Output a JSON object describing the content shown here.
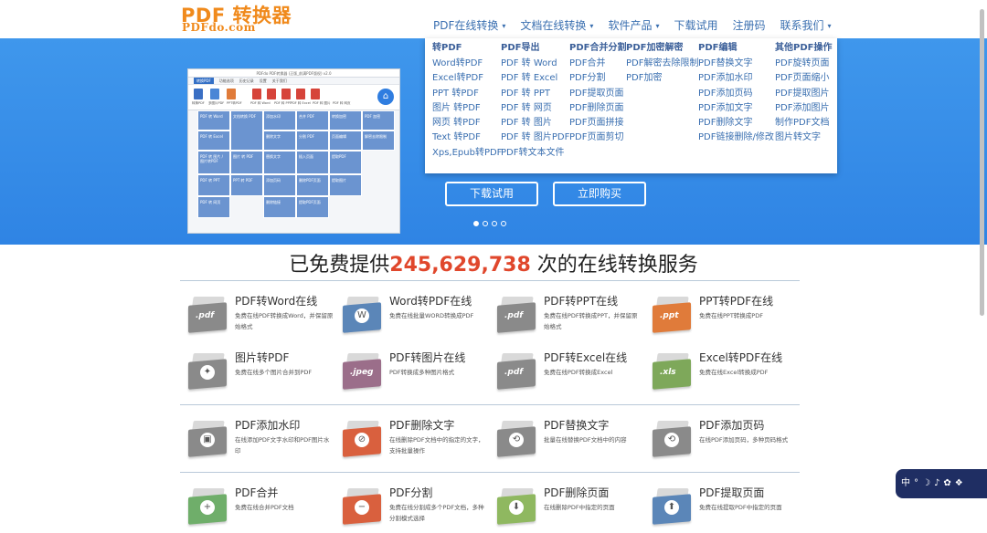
{
  "logo": {
    "main": "PDF 转换器",
    "sub": "PDFdo.com"
  },
  "nav": [
    {
      "label": "PDF在线转换",
      "caret": "▾"
    },
    {
      "label": "文档在线转换",
      "caret": "▾"
    },
    {
      "label": "软件产品",
      "caret": "▾"
    },
    {
      "label": "下载试用",
      "caret": ""
    },
    {
      "label": "注册码",
      "caret": ""
    },
    {
      "label": "联系我们",
      "caret": "▾"
    }
  ],
  "dropdown": [
    {
      "head": "转PDF",
      "items": [
        "Word转PDF",
        "Excel转PDF",
        "PPT 转PDF",
        "图片 转PDF",
        "网页 转PDF",
        "Text 转PDF",
        "Xps,Epub转PDF"
      ]
    },
    {
      "head": "PDF导出",
      "items": [
        "PDF 转 Word",
        "PDF 转 Excel",
        "PDF 转 PPT",
        "PDF 转 网页",
        "PDF 转 图片",
        "PDF 转 图片PDF",
        "PDF转文本文件"
      ]
    },
    {
      "head": "PDF合并分割",
      "items": [
        "PDF合并",
        "PDF分割",
        "PDF提取页面",
        "PDF删除页面",
        "PDF页面拼接",
        "PDF页面剪切"
      ]
    },
    {
      "head": "PDF加密解密",
      "items": [
        "PDF解密去除限制",
        "PDF加密"
      ]
    },
    {
      "head": "PDF编辑",
      "items": [
        "PDF替换文字",
        "PDF添加水印",
        "PDF添加页码",
        "PDF添加文字",
        "PDF删除文字",
        "PDF链接删除/修改"
      ]
    },
    {
      "head": "其他PDF操作",
      "items": [
        "PDF旋转页面",
        "PDF页面缩小",
        "PDF提取图片",
        "PDF添加图片",
        "制作PDF文档",
        "图片转文字"
      ]
    }
  ],
  "banner": {
    "download_label": "下载试用",
    "buy_label": "立即购买",
    "screenshot": {
      "title": "PDFdo PDF转换器 (正版_前满PDF版权) v2.0",
      "menu": [
        "转换PDF",
        "功能选项",
        "历史记录",
        "设置",
        "关于我们"
      ],
      "tools": [
        "转换PDF",
        "多图片PDF",
        "PPT转PDF",
        "PDF 转 Word",
        "PDF 转 PPT",
        "PDF 转 Excel",
        "PDF 转 图片",
        "PDF 转 网页"
      ],
      "cells": [
        "PDF 转 Word",
        "文档转换 PDF",
        "添加水印",
        "合并 PDF",
        "转换加密",
        "PDF 加密",
        "PDF 转 Excel",
        "删除文字",
        "分割 PDF",
        "页面编辑",
        "解密去除限制",
        "PDF 转 图片 / 图片转PDF",
        "图片 转 PDF",
        "替换文字",
        "插入页面",
        "提取PDF",
        "PDF 转 PPT",
        "PPT 转 PDF",
        "添加页码",
        "删除PDF页面",
        "提取图片",
        "PDF 转 网页",
        "删除链接",
        "提取PDF页面"
      ]
    }
  },
  "counter": {
    "before": "已免费提供",
    "number": "245,629,738",
    "after": " 次的在线转换服务"
  },
  "services": [
    {
      "title": "PDF转Word在线",
      "desc": "免费在线PDF转换成Word，并保留原始格式",
      "icon": ".pdf",
      "color": "#8a8a8a"
    },
    {
      "title": "Word转PDF在线",
      "desc": "免费在线批量WORD转换成PDF",
      "icon": "W",
      "color": "#5b86b8"
    },
    {
      "title": "PDF转PPT在线",
      "desc": "免费在线PDF转换成PPT，并保留原始格式",
      "icon": ".pdf",
      "color": "#8a8a8a"
    },
    {
      "title": "PPT转PDF在线",
      "desc": "免费在线PPT转换成PDF",
      "icon": ".ppt",
      "color": "#e07b3a"
    },
    {
      "title": "图片转PDF",
      "desc": "免费在线多个图片合并到PDF",
      "icon": "✦",
      "color": "#8a8a8a"
    },
    {
      "title": "PDF转图片在线",
      "desc": "PDF转换成多种图片格式",
      "icon": ".jpeg",
      "color": "#9b6e8a"
    },
    {
      "title": "PDF转Excel在线",
      "desc": "免费在线PDF转换成Excel",
      "icon": ".pdf",
      "color": "#8a8a8a"
    },
    {
      "title": "Excel转PDF在线",
      "desc": "免费在线Excel转换成PDF",
      "icon": ".xls",
      "color": "#7ea85a"
    },
    {
      "title": "PDF添加水印",
      "desc": "在线添加PDF文字水印和PDF图片水印",
      "icon": "▣",
      "color": "#8a8a8a"
    },
    {
      "title": "PDF删除文字",
      "desc": "在线删除PDF文档中的指定的文字，支持批量操作",
      "icon": "⊘",
      "color": "#d9603e"
    },
    {
      "title": "PDF替换文字",
      "desc": "批量在线替换PDF文档中的内容",
      "icon": "⟲",
      "color": "#8a8a8a"
    },
    {
      "title": "PDF添加页码",
      "desc": "在线PDF添加页码，多种页码格式",
      "icon": "⟲",
      "color": "#8a8a8a"
    },
    {
      "title": "PDF合并",
      "desc": "免费在线合并PDF文档",
      "icon": "+",
      "color": "#6fae6a"
    },
    {
      "title": "PDF分割",
      "desc": "免费在线分割成多个PDF文档，多种分割模式选择",
      "icon": "−",
      "color": "#d9603e"
    },
    {
      "title": "PDF删除页面",
      "desc": "在线删除PDF中指定的页面",
      "icon": "⬇",
      "color": "#8fb860"
    },
    {
      "title": "PDF提取页面",
      "desc": "免费在线提取PDF中指定的页面",
      "icon": "⬆",
      "color": "#5b86b8"
    }
  ],
  "widget": {
    "text": "中",
    "symbols": [
      "°",
      "☽",
      "♪",
      "✿",
      "❖"
    ]
  },
  "colors": {
    "brand_orange": "#f08a1c",
    "banner_blue": "#3f97ec",
    "nav_blue": "#3a6fb0",
    "counter_red": "#e0472c"
  }
}
